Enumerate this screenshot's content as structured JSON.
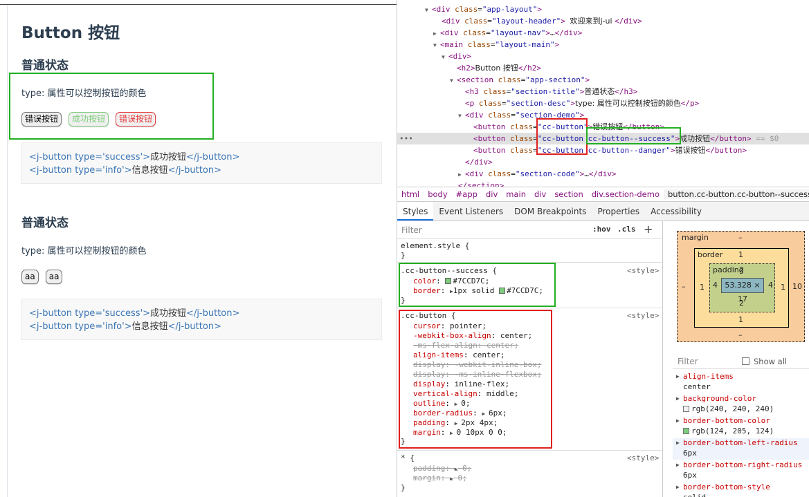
{
  "page": {
    "title": "Button 按钮",
    "sections": [
      {
        "title": "普通状态",
        "desc": "type: 属性可以控制按钮的颜色",
        "buttons": [
          "错误按钮",
          "成功按钮",
          "错误按钮"
        ],
        "code": [
          {
            "open": "<j-button type='success'>",
            "text": "成功按钮",
            "close": "</j-button>"
          },
          {
            "open": "<j-button type='info'>",
            "text": "信息按钮",
            "close": "</j-button>"
          }
        ]
      },
      {
        "title": "普通状态",
        "desc": "type: 属性可以控制按钮的颜色",
        "buttons": [
          "aa",
          "aa"
        ],
        "code": [
          {
            "open": "<j-button type='success'>",
            "text": "成功按钮",
            "close": "</j-button>"
          },
          {
            "open": "<j-button type='info'>",
            "text": "信息按钮",
            "close": "</j-button>"
          }
        ]
      }
    ]
  },
  "devtools": {
    "dom": {
      "l1": {
        "tag": "div",
        "cls": "app-layout"
      },
      "l2": {
        "tag": "div",
        "cls": "layout-header",
        "text": "欢迎来到j-ui "
      },
      "l3": {
        "tag": "div",
        "cls": "layout-nav",
        "ellipsis": "…"
      },
      "l4": {
        "tag": "main",
        "cls": "layout-main"
      },
      "l5": {
        "tag": "div"
      },
      "l6": {
        "tag": "h2",
        "text": "Button 按钮"
      },
      "l7": {
        "tag": "section",
        "cls": "app-section"
      },
      "l8": {
        "tag": "h3",
        "cls": "section-title",
        "text": "普通状态"
      },
      "l9": {
        "tag": "p",
        "cls": "section-desc",
        "text": "type: 属性可以控制按钮的颜色"
      },
      "l10": {
        "tag": "div",
        "cls": "section-demo"
      },
      "l11": {
        "tag": "button",
        "cls": "cc-button",
        "text": "错误按钮"
      },
      "l12": {
        "tag": "button",
        "cls1": "cc-button",
        "cls2": "cc-button--success",
        "text": "成功按钮",
        "suffix": " == $0"
      },
      "l13": {
        "tag": "button",
        "cls1": "cc-button",
        "cls2": "cc-button--danger",
        "text": "错误按钮"
      },
      "l14": {
        "tag": "div"
      },
      "l15": {
        "tag": "div",
        "cls": "section-code",
        "ellipsis": "…"
      },
      "l16": {
        "tag": "section"
      }
    },
    "dots": "•••",
    "breadcrumbs": [
      "html",
      "body",
      "#app",
      "div",
      "main",
      "div",
      "section",
      "div.section-demo",
      "button.cc-button.cc-button--success"
    ],
    "tabs": [
      "Styles",
      "Event Listeners",
      "DOM Breakpoints",
      "Properties",
      "Accessibility"
    ],
    "filter_placeholder": "Filter",
    "hov": ":hov",
    "cls": ".cls",
    "plus": "+",
    "rules": {
      "element_style": "element.style {",
      "success": {
        "selector": ".cc-button--success {",
        "source": "<style>",
        "color_name": "color",
        "color_val": "#7CCD7C;",
        "border_name": "border",
        "border_val": "1px solid ",
        "border_color": "#7CCD7C;"
      },
      "ccbutton": {
        "selector": ".cc-button {",
        "source": "<style>",
        "props": [
          {
            "name": "cursor",
            "value": "pointer;",
            "strike": false,
            "arrow": false
          },
          {
            "name": "-webkit-box-align",
            "value": "center;",
            "strike": false,
            "arrow": false
          },
          {
            "name": "-ms-flex-align",
            "value": "center;",
            "strike": true,
            "arrow": false
          },
          {
            "name": "align-items",
            "value": "center;",
            "strike": false,
            "arrow": false
          },
          {
            "name": "display",
            "value": "-webkit-inline-box;",
            "strike": true,
            "arrow": false
          },
          {
            "name": "display",
            "value": "-ms-inline-flexbox;",
            "strike": true,
            "arrow": false
          },
          {
            "name": "display",
            "value": "inline-flex;",
            "strike": false,
            "arrow": false
          },
          {
            "name": "vertical-align",
            "value": "middle;",
            "strike": false,
            "arrow": false
          },
          {
            "name": "outline",
            "value": "0;",
            "strike": false,
            "arrow": true
          },
          {
            "name": "border-radius",
            "value": "6px;",
            "strike": false,
            "arrow": true
          },
          {
            "name": "padding",
            "value": "2px 4px;",
            "strike": false,
            "arrow": true
          },
          {
            "name": "margin",
            "value": "0 10px 0 0;",
            "strike": false,
            "arrow": true
          }
        ]
      },
      "star": {
        "selector": "* {",
        "source": "<style>",
        "props": [
          {
            "name": "padding",
            "value": "0;"
          },
          {
            "name": "margin",
            "value": "0;"
          }
        ]
      },
      "close": "}"
    },
    "boxmodel": {
      "margin_label": "margin",
      "margin_top": "–",
      "margin_bottom": "–",
      "margin_left": "–",
      "margin_right": "10",
      "border_label": "border",
      "border_top": "1",
      "border_bottom": "1",
      "border_left": "1",
      "border_right": "1",
      "padding_label": "padding",
      "padding_top": "2",
      "padding_bottom": "2",
      "padding_left": "4",
      "padding_right": "4",
      "content": "53.328 × 17"
    },
    "computed": {
      "filter_placeholder": "Filter",
      "show_all": "Show all",
      "props": [
        {
          "name": "align-items",
          "value": "center"
        },
        {
          "name": "background-color",
          "value": "rgb(240, 240, 240)",
          "swatch": "#f0f0f0"
        },
        {
          "name": "border-bottom-color",
          "value": "rgb(124, 205, 124)",
          "swatch": "#7CCD7C"
        },
        {
          "name": "border-bottom-left-radius",
          "value": "6px"
        },
        {
          "name": "border-bottom-right-radius",
          "value": "6px"
        },
        {
          "name": "border-bottom-style",
          "value": "solid"
        }
      ]
    }
  }
}
